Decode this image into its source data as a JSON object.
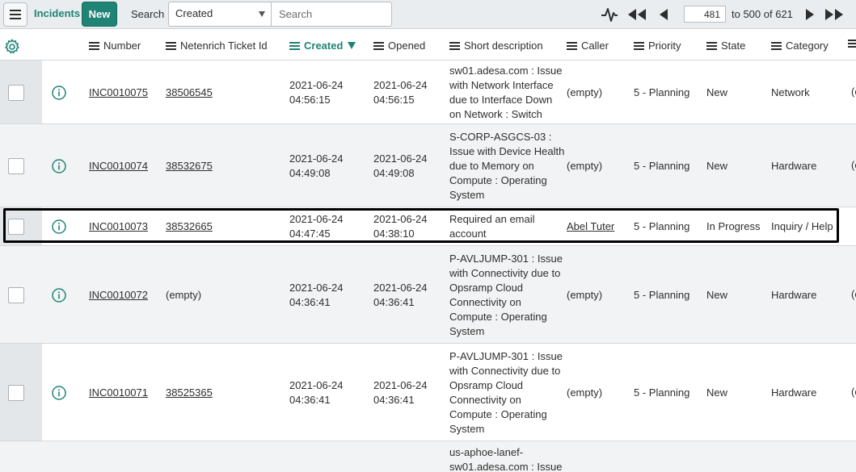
{
  "header": {
    "title": "Incidents",
    "new_label": "New",
    "search_label": "Search",
    "search_field": "Created",
    "search_placeholder": "Search",
    "page_value": "481",
    "page_range": "to 500 of 621"
  },
  "columns": [
    {
      "key": "number",
      "label": "Number"
    },
    {
      "key": "ticket",
      "label": "Netenrich Ticket Id"
    },
    {
      "key": "created",
      "label": "Created"
    },
    {
      "key": "opened",
      "label": "Opened"
    },
    {
      "key": "short",
      "label": "Short description"
    },
    {
      "key": "caller",
      "label": "Caller"
    },
    {
      "key": "priority",
      "label": "Priority"
    },
    {
      "key": "state",
      "label": "State"
    },
    {
      "key": "category",
      "label": "Category"
    }
  ],
  "rows": [
    {
      "number": "INC0010075",
      "ticket": "38506545",
      "created_date": "2021-06-24",
      "created_time": "04:56:15",
      "opened_date": "2021-06-24",
      "opened_time": "04:56:15",
      "short_lines": [
        "sw01.adesa.com : Issue",
        "with Network Interface",
        "due to Interface Down",
        "on Network : Switch"
      ],
      "caller": "(empty)",
      "priority": "5 - Planning",
      "state": "New",
      "category": "Network",
      "cut": "(e"
    },
    {
      "number": "INC0010074",
      "ticket": "38532675",
      "created_date": "2021-06-24",
      "created_time": "04:49:08",
      "opened_date": "2021-06-24",
      "opened_time": "04:49:08",
      "short_lines": [
        "S-CORP-ASGCS-03 :",
        "Issue with Device Health",
        "due to Memory on",
        "Compute : Operating",
        "System"
      ],
      "caller": "(empty)",
      "priority": "5 - Planning",
      "state": "New",
      "category": "Hardware",
      "cut": "(e"
    },
    {
      "number": "INC0010073",
      "ticket": "38532665",
      "created_date": "2021-06-24",
      "created_time": "04:47:45",
      "opened_date": "2021-06-24",
      "opened_time": "04:38:10",
      "short_lines": [
        "Required an email",
        "account"
      ],
      "caller": "Abel Tuter",
      "priority": "5 - Planning",
      "state": "In Progress",
      "category": "Inquiry / Help",
      "cut": ""
    },
    {
      "number": "INC0010072",
      "ticket": "(empty)",
      "created_date": "2021-06-24",
      "created_time": "04:36:41",
      "opened_date": "2021-06-24",
      "opened_time": "04:36:41",
      "short_lines": [
        "P-AVLJUMP-301 : Issue",
        "with Connectivity due to",
        "Opsramp Cloud",
        "Connectivity on",
        "Compute : Operating",
        "System"
      ],
      "caller": "(empty)",
      "priority": "5 - Planning",
      "state": "New",
      "category": "Hardware",
      "cut": "(e"
    },
    {
      "number": "INC0010071",
      "ticket": "38525365",
      "created_date": "2021-06-24",
      "created_time": "04:36:41",
      "opened_date": "2021-06-24",
      "opened_time": "04:36:41",
      "short_lines": [
        "P-AVLJUMP-301 : Issue",
        "with Connectivity due to",
        "Opsramp Cloud",
        "Connectivity on",
        "Compute : Operating",
        "System"
      ],
      "caller": "(empty)",
      "priority": "5 - Planning",
      "state": "New",
      "category": "Hardware",
      "cut": "(e"
    },
    {
      "number": "",
      "ticket": "",
      "created_date": "",
      "created_time": "",
      "opened_date": "",
      "opened_time": "",
      "short_lines": [
        "us-aphoe-lanef-",
        "sw01.adesa.com : Issue"
      ],
      "caller": "",
      "priority": "",
      "state": "",
      "category": "",
      "cut": ""
    }
  ],
  "colors": {
    "accent": "#1f8476",
    "gutter": "#e4e7ea",
    "header_bg": "#eaedf0"
  }
}
